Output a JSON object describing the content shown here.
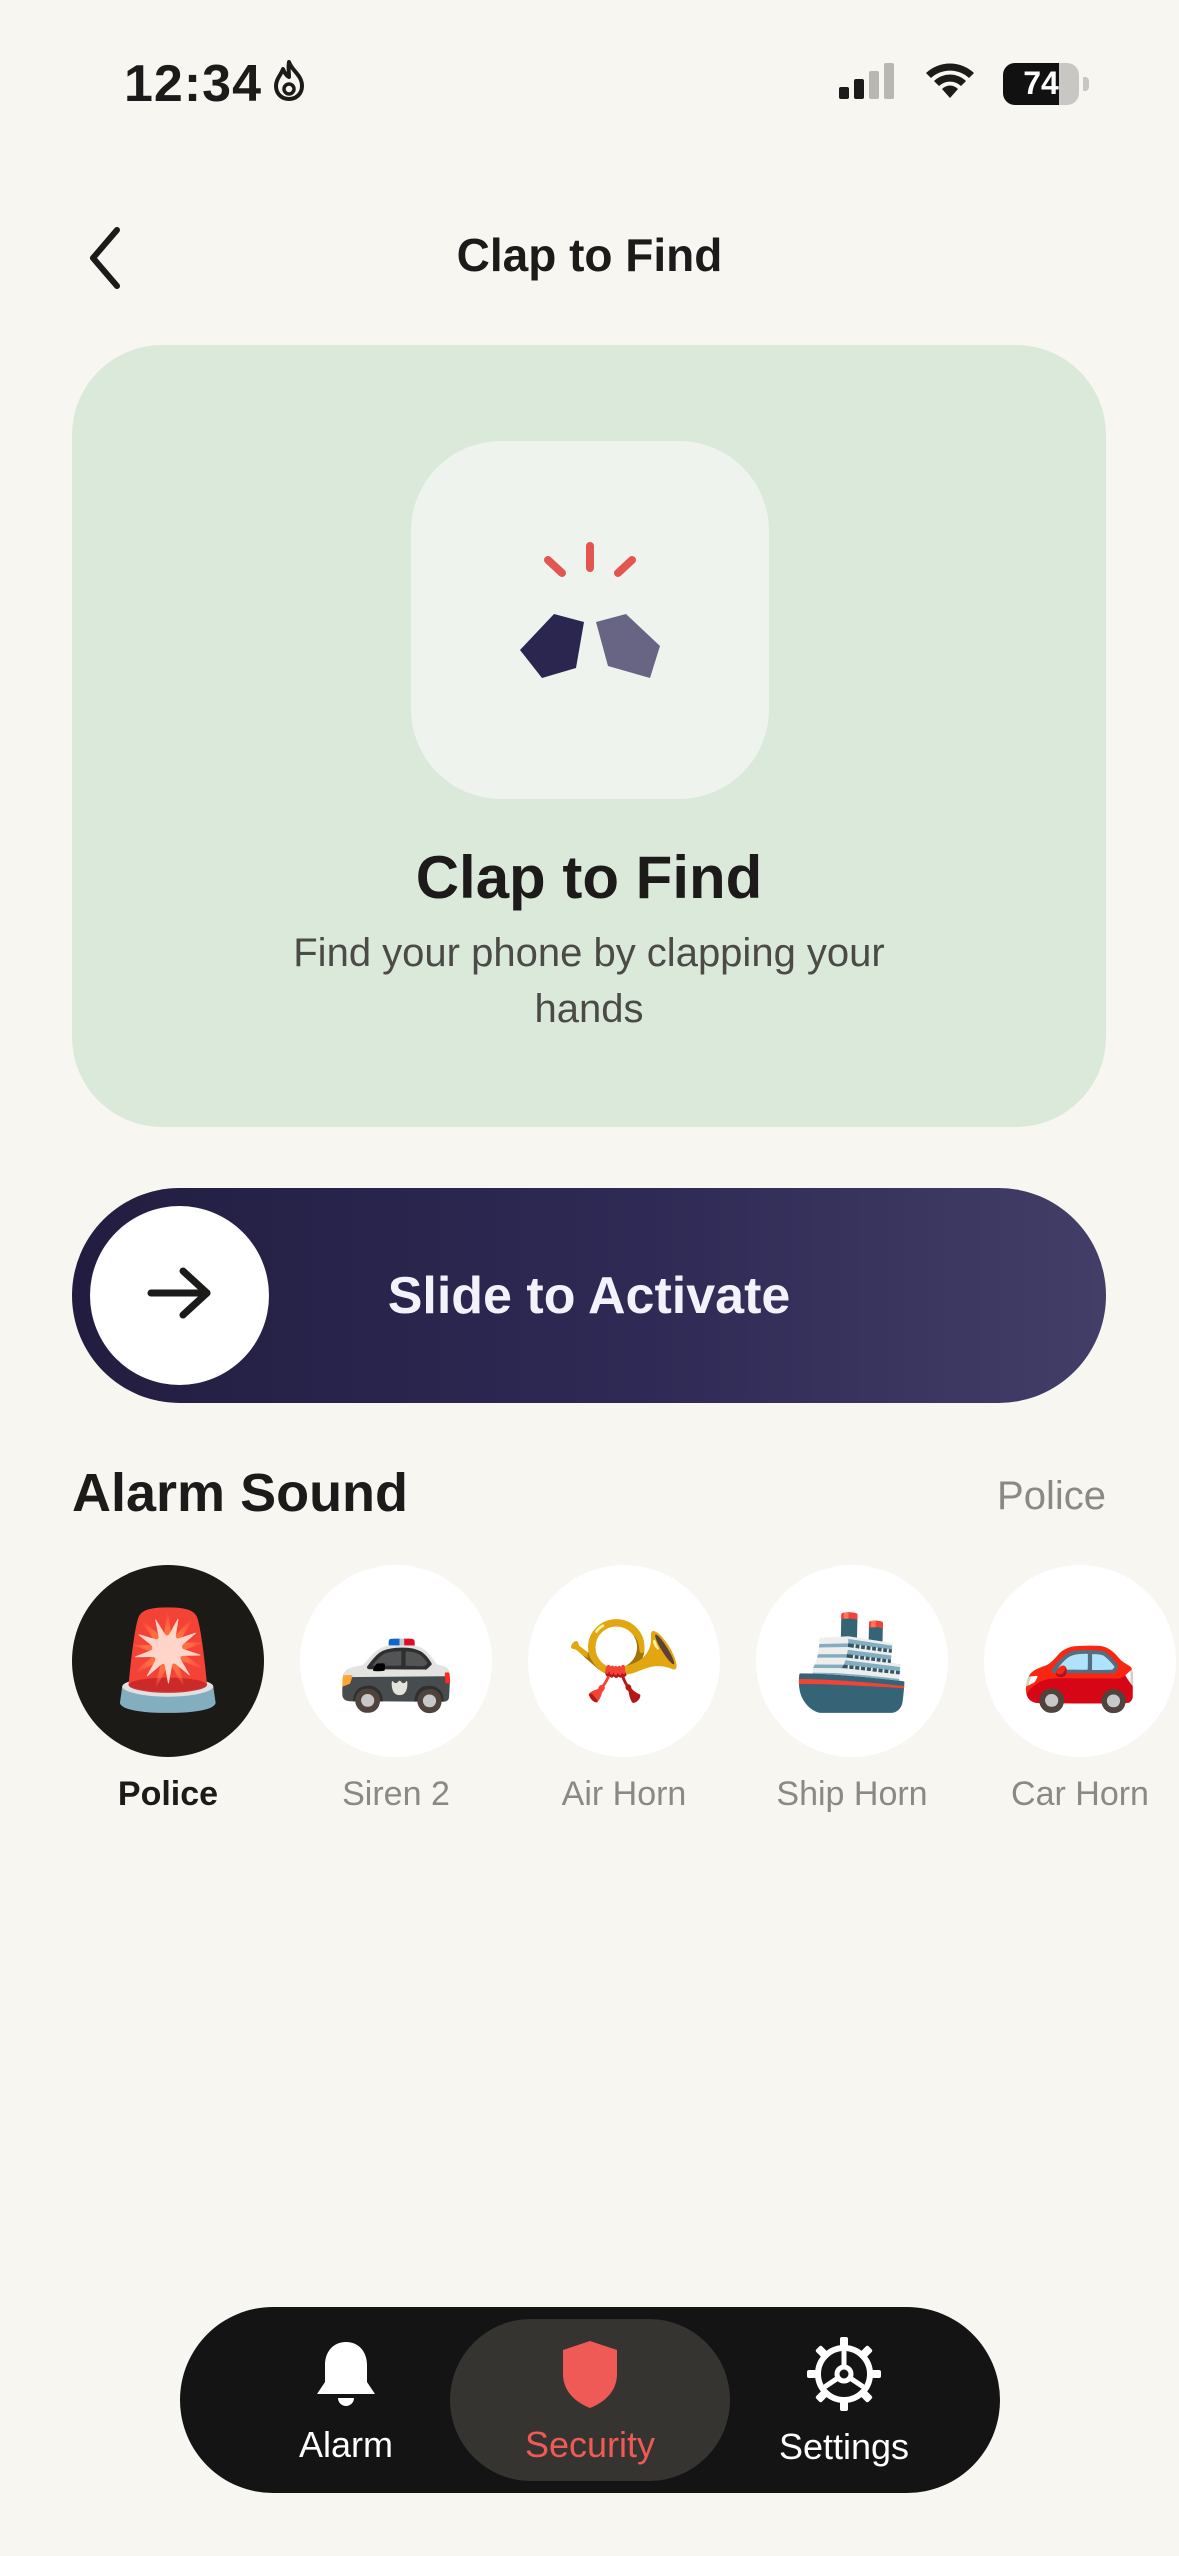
{
  "status_bar": {
    "time": "12:34",
    "battery_level": "74",
    "battery_fraction": 0.74,
    "icons": [
      "flame-icon",
      "cellular-signal-icon",
      "wifi-icon",
      "battery-icon"
    ]
  },
  "header": {
    "title": "Clap to Find",
    "back_icon": "chevron-left-icon"
  },
  "hero": {
    "title": "Clap to Find",
    "subtitle": "Find your phone by clapping your hands",
    "icon": "clap-hands-icon",
    "colors": {
      "card_bg": "#dbe9da",
      "tile_bg": "#eef4ed",
      "clap_dark": "#2b2650",
      "clap_light": "#676583",
      "spark": "#e2564f"
    }
  },
  "slider": {
    "label": "Slide to Activate",
    "knob_icon": "arrow-right-icon"
  },
  "alarm_sound": {
    "title": "Alarm Sound",
    "selected_value": "Police",
    "options": [
      {
        "label": "Police",
        "emoji": "🚨",
        "selected": true
      },
      {
        "label": "Siren 2",
        "emoji": "🚓",
        "selected": false
      },
      {
        "label": "Air Horn",
        "emoji": "📯",
        "selected": false
      },
      {
        "label": "Ship Horn",
        "emoji": "🚢",
        "selected": false
      },
      {
        "label": "Car Horn",
        "emoji": "🚗",
        "selected": false
      }
    ]
  },
  "bottom_nav": {
    "items": [
      {
        "label": "Alarm",
        "icon": "bell-icon",
        "active": false
      },
      {
        "label": "Security",
        "icon": "shield-icon",
        "active": true
      },
      {
        "label": "Settings",
        "icon": "gear-icon",
        "active": false
      }
    ],
    "active_color": "#f05a56"
  }
}
